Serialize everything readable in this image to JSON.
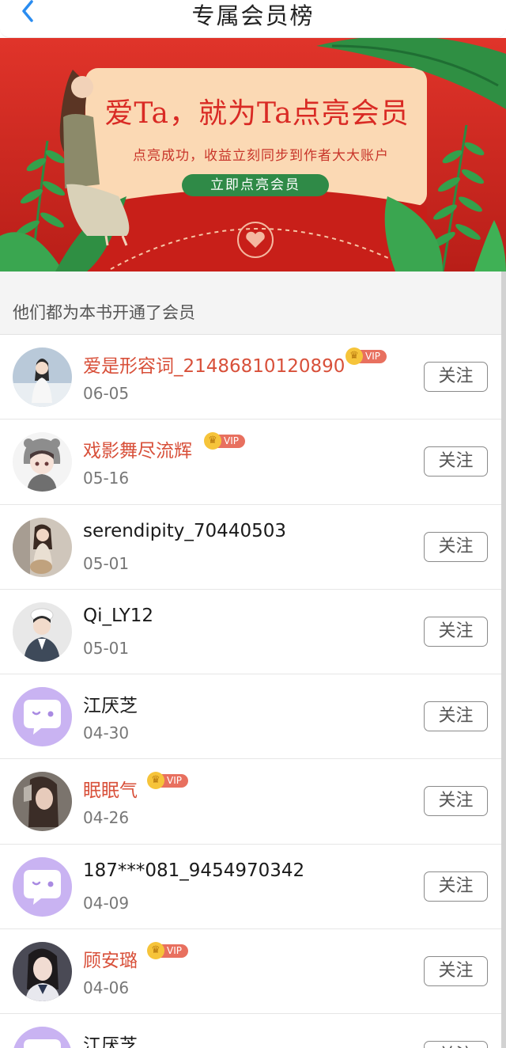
{
  "header": {
    "title": "专属会员榜"
  },
  "banner": {
    "title": "爱Ta，就为Ta点亮会员",
    "subtitle": "点亮成功，收益立刻同步到作者大大账户",
    "button_label": "立即点亮会员"
  },
  "section": {
    "title": "他们都为本书开通了会员"
  },
  "colors": {
    "vip_name": "#d8503a",
    "banner_red": "#d42a22",
    "banner_button": "#2f8a47",
    "default_avatar": "#c9b3f2"
  },
  "members": [
    {
      "name": "爱是形容词_21486810120890",
      "date": "06-05",
      "vip": true,
      "vip_label": "VIP",
      "follow_label": "关注",
      "avatar": "photo-avatar-white-coat"
    },
    {
      "name": "戏影舞尽流辉",
      "date": "05-16",
      "vip": true,
      "vip_label": "VIP",
      "follow_label": "关注",
      "avatar": "anime-avatar-grey-hood"
    },
    {
      "name": "serendipity_70440503",
      "date": "05-01",
      "vip": false,
      "follow_label": "关注",
      "avatar": "photo-avatar-with-dog"
    },
    {
      "name": "Qi_LY12",
      "date": "05-01",
      "vip": false,
      "follow_label": "关注",
      "avatar": "photo-avatar-boy-hat"
    },
    {
      "name": "江厌芝",
      "date": "04-30",
      "vip": false,
      "follow_label": "关注",
      "avatar": "default-chat-avatar"
    },
    {
      "name": "眠眠气",
      "date": "04-26",
      "vip": true,
      "vip_label": "VIP",
      "follow_label": "关注",
      "avatar": "photo-avatar-dark-hair"
    },
    {
      "name": "187***081_9454970342",
      "date": "04-09",
      "vip": false,
      "follow_label": "关注",
      "avatar": "default-chat-avatar"
    },
    {
      "name": "顾安璐",
      "date": "04-06",
      "vip": true,
      "vip_label": "VIP",
      "follow_label": "关注",
      "avatar": "photo-avatar-school-girl"
    },
    {
      "name": "江厌芝",
      "date": "",
      "vip": false,
      "follow_label": "关注",
      "avatar": "default-chat-avatar"
    }
  ]
}
